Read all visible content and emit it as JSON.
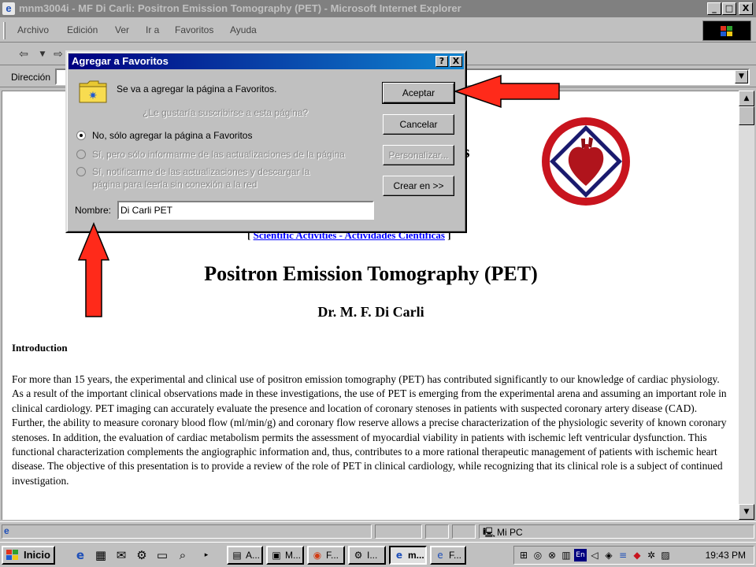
{
  "window": {
    "title": "mnm3004i - MF Di Carli: Positron Emission Tomography (PET) - Microsoft Internet Explorer",
    "min": "_",
    "max": "□",
    "close": "X"
  },
  "menu": [
    "Archivo",
    "Edición",
    "Ver",
    "Ir a",
    "Favoritos",
    "Ayuda"
  ],
  "address": {
    "label": "Dirección",
    "value": ""
  },
  "page": {
    "site_heading": "s",
    "nav_open": "[ ",
    "nav_link": "Scientific Activities - Actividades Cientificas",
    "nav_close": " ]",
    "title": "Positron Emission Tomography (PET)",
    "author": "Dr. M. F. Di Carli",
    "intro_heading": "Introduction",
    "intro_body": "For more than 15 years, the experimental and clinical use of positron emission tomography (PET) has contributed significantly to our knowledge of cardiac physiology. As a result of the important clinical observations made in these investigations, the use of PET is emerging from the experimental arena and assuming an important role in clinical cardiology. PET imaging can accurately evaluate the presence and location of coronary stenoses in patients with suspected coronary artery disease (CAD). Further, the ability to measure coronary blood flow (ml/min/g) and coronary flow reserve allows a precise characterization of the physiologic severity of known coronary stenoses. In addition, the evaluation of cardiac metabolism permits the assessment of myocardial viability in patients with ischemic left ventricular dysfunction. This functional characterization complements the angiographic information and, thus, contributes to a more rational therapeutic management of patients with ischemic heart disease. The objective of this presentation is to provide a review of the role of PET in clinical cardiology, while recognizing that its clinical role is a subject of continued investigation."
  },
  "dialog": {
    "title": "Agregar a Favoritos",
    "help": "?",
    "close": "X",
    "message": "Se va a agregar la página a Favoritos.",
    "question": "¿Le gustaría suscribirse a esta página?",
    "options": [
      "No, sólo agregar la página a Favoritos",
      "Sí, pero sólo informarme de las actualizaciones de la página",
      "Sí, notificarme de las actualizaciones y descargar la",
      "página para leerla sin conexión a la red"
    ],
    "name_label": "Nombre:",
    "name_value": "Di Carli PET",
    "buttons": {
      "ok": "Aceptar",
      "cancel": "Cancelar",
      "customize": "Personalizar...",
      "create": "Crear en >>"
    }
  },
  "status": {
    "zone": "Mi PC"
  },
  "taskbar": {
    "start": "Inicio",
    "tasks": [
      "A...",
      "M...",
      "F...",
      "I...",
      "m...",
      "F..."
    ],
    "clock": "19:43 PM"
  },
  "colors": {
    "title_inactive": "#808080",
    "dialog_title": "#000080",
    "link": "#0000ff",
    "arrow": "#ff2a1a",
    "logo_red": "#c8141e",
    "logo_navy": "#1a1a6e"
  }
}
